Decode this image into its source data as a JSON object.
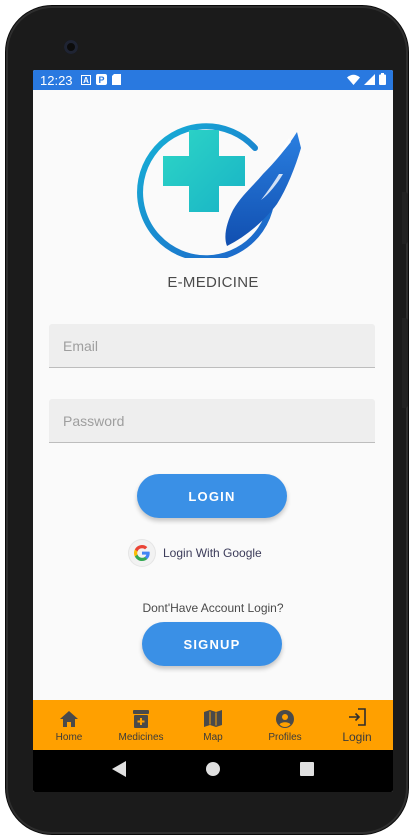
{
  "status_bar": {
    "time": "12:23",
    "icons": [
      "a-icon",
      "p-icon",
      "sd-card-icon",
      "wifi-icon",
      "signal-icon",
      "battery-icon"
    ]
  },
  "app": {
    "title": "E-MEDICINE",
    "logo_icon": "medical-cross-hand-logo"
  },
  "form": {
    "email_placeholder": "Email",
    "password_placeholder": "Password",
    "login_label": "LOGIN",
    "google_label": "Login With Google",
    "no_account_text": "Dont'Have Account Login?",
    "signup_label": "SIGNUP"
  },
  "bottom_nav": {
    "items": [
      {
        "label": "Home",
        "icon": "home-icon"
      },
      {
        "label": "Medicines",
        "icon": "medicine-box-icon"
      },
      {
        "label": "Map",
        "icon": "map-icon"
      },
      {
        "label": "Profiles",
        "icon": "account-circle-icon"
      },
      {
        "label": "Login",
        "icon": "login-icon"
      }
    ],
    "active": "Login"
  },
  "colors": {
    "status_bar": "#2979e0",
    "primary_button": "#3a90e6",
    "bottom_nav": "#ffa000",
    "logo_teal": "#1fc9c8",
    "logo_blue": "#1560c8"
  }
}
